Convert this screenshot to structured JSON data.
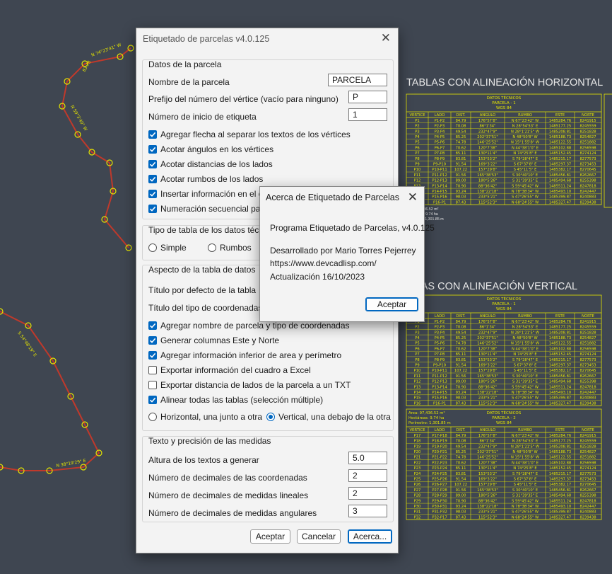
{
  "colors": {
    "cad_bg": "#3f4651",
    "cad_line": "#e6e600",
    "parcel_line": "#c0392b",
    "accent": "#0067c0"
  },
  "main_dialog": {
    "title": "Etiquetado de parcelas v4.0.125",
    "close_icon": "close-icon",
    "group_datos": {
      "title": "Datos de la parcela",
      "nombre_label": "Nombre de la parcela",
      "nombre_value": "PARCELA",
      "prefijo_label": "Prefijo del número del vértice (vacío para ninguno)",
      "prefijo_value": "P",
      "inicio_label": "Número de inicio de etiqueta",
      "inicio_value": "1",
      "checks": [
        {
          "label": "Agregar flecha al separar los textos de los vértices",
          "checked": true
        },
        {
          "label": "Acotar ángulos en los vértices",
          "checked": true
        },
        {
          "label": "Acotar distancias de los lados",
          "checked": true
        },
        {
          "label": "Acotar rumbos de los lados",
          "checked": true
        },
        {
          "label": "Insertar información en el cent",
          "checked": true
        },
        {
          "label": "Numeración secuencial para to",
          "checked": true
        }
      ]
    },
    "group_tipo": {
      "title": "Tipo de tabla de los datos técnico",
      "options": [
        {
          "label": "Simple",
          "selected": false
        },
        {
          "label": "Rumbos",
          "selected": false
        }
      ]
    },
    "group_aspecto": {
      "title": "Aspecto de la tabla de datos",
      "titulo_label": "Título por defecto de la tabla",
      "titulo_coord_label": "Título del tipo de coordenadas",
      "checks": [
        {
          "label": "Agregar nombre de parcela y tipo de coordenadas",
          "checked": true
        },
        {
          "label": "Generar columnas Este y Norte",
          "checked": true
        },
        {
          "label": "Agregar información inferior de area y perímetro",
          "checked": true
        },
        {
          "label": "Exportar información del cuadro a Excel",
          "checked": false
        },
        {
          "label": "Exportar distancia de lados de la parcela a un TXT",
          "checked": false
        },
        {
          "label": "Alinear todas las tablas (selección múltiple)",
          "checked": true
        }
      ],
      "align_options": [
        {
          "label": "Horizontal, una junto a otra",
          "selected": false
        },
        {
          "label": "Vertical, una debajo de la otra",
          "selected": true
        }
      ]
    },
    "group_texto": {
      "title": "Texto y precisión de las medidas",
      "fields": [
        {
          "label": "Altura de los textos a generar",
          "value": "5.0"
        },
        {
          "label": "Número de decimales de las coordenadas",
          "value": "2"
        },
        {
          "label": "Número de decimales de medidas lineales",
          "value": "2"
        },
        {
          "label": "Número de decimales de medidas angulares",
          "value": "3"
        }
      ]
    },
    "buttons": {
      "aceptar": "Aceptar",
      "cancelar": "Cancelar",
      "acerca": "Acerca..."
    }
  },
  "about_dialog": {
    "title": "Acerca de Etiquetado de Parcelas",
    "line1": "Programa Etiquetado de Parcelas, v4.0.125",
    "line2": "Desarrollado por Mario Torres Pejerrey",
    "line3": "https://www.devcadlisp.com/",
    "line4": "Actualización 16/10/2023",
    "ok": "Aceptar"
  },
  "cad": {
    "heading_h": "TABLAS CON ALINEACIÓN HORIZONTAL",
    "heading_v": "BLAS CON ALINEACIÓN VERTICAL",
    "table_title": "DATOS TÉCNICOS",
    "parcel1": "PARCELA - 1",
    "parcel2": "PARCELA - 2",
    "datum": "WGS 84",
    "columns": [
      "VERTICE",
      "LADO",
      "DIST.",
      "ANGULO",
      "RUMBO",
      "ESTE",
      "NORTE"
    ],
    "rows": [
      [
        "P1",
        "P1-P2",
        "84.79",
        "176°57'8\"",
        "N 67°23'42\" W",
        "1485284.76",
        "8241915"
      ],
      [
        "P2",
        "P2-P3",
        "70.08",
        "86°1'34\"",
        "N 28°54'53\" E",
        "1485177.25",
        "8245559"
      ],
      [
        "P3",
        "P3-P4",
        "49.54",
        "232°47'9\"",
        "N 28°1'21'5\" W",
        "1485208.81",
        "8251828"
      ],
      [
        "P4",
        "P4-P5",
        "85.25",
        "202°37'51\"",
        "N 48°50'8\" W",
        "1485188.73",
        "8254827"
      ],
      [
        "P5",
        "P5-P6",
        "74.78",
        "146°25'52\"",
        "N 15°1'55'8\" W",
        "1485122.55",
        "8251882"
      ],
      [
        "P6",
        "P6-P7",
        "70.62",
        "120°7'38\"",
        "N 44°38'1'0\" E",
        "1485102.88",
        "8256598"
      ],
      [
        "P7",
        "P7-P8",
        "85.11",
        "130°11'4\"",
        "N 74°25'8\" E",
        "1485152.45",
        "8274124"
      ],
      [
        "P8",
        "P8-P9",
        "83.81",
        "153°53'2\"",
        "S 79°28'47\" E",
        "1485215.17",
        "8277573"
      ],
      [
        "P9",
        "P9-P10",
        "91.54",
        "169°3'22\"",
        "S 67°37'8\" E",
        "1485297.37",
        "8273453"
      ],
      [
        "P10",
        "P10-P11",
        "107.22",
        "157°29'8\"",
        "S 45°11'5\" E",
        "1485382.17",
        "8270645"
      ],
      [
        "P11",
        "P11-P12",
        "91.56",
        "165°38'53\"",
        "S 30°40'10\" E",
        "1485456.81",
        "8262667"
      ],
      [
        "P12",
        "P12-P13",
        "89.00",
        "180°5'26\"",
        "S 31°39'35\" E",
        "1485494.68",
        "8255398"
      ],
      [
        "P13",
        "P13-P14",
        "70.90",
        "88°36'42\"",
        "S 59°45'42\" W",
        "1485511.24",
        "8247818"
      ],
      [
        "P14",
        "P14-P15",
        "93.24",
        "138°22'18\"",
        "N 78°38'34\" W",
        "1485493.10",
        "8242447"
      ],
      [
        "P15",
        "P15-P16",
        "98.03",
        "233°5'21\"",
        "S 47°26'55\" W",
        "1485399.87",
        "8240883"
      ],
      [
        "P16",
        "P16-P1",
        "87.43",
        "115°52'3\"",
        "N 68°24'55\" W",
        "1485327.47",
        "8239438"
      ]
    ],
    "area_label": "Area: 97,436.52 m²",
    "ha_label": "Hectáreas: 9.74 ha",
    "per_label": "Perímetro: 1,301.85 m",
    "arrow_labels": [
      "N 74°23'41\" W",
      "83.78",
      "N 59°3'40\" W",
      "S 54°48'19\" E",
      "N 38°19'29\" E"
    ]
  }
}
